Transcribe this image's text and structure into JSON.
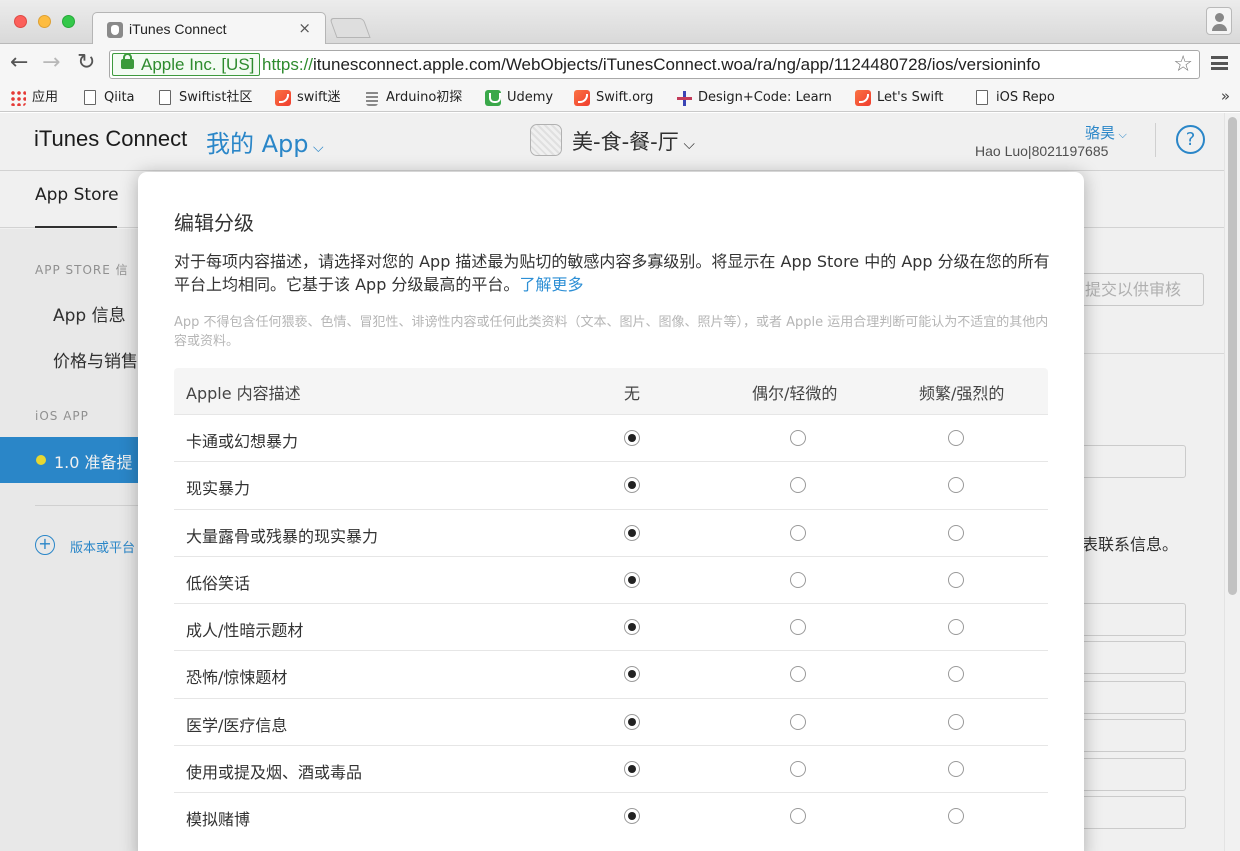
{
  "browser": {
    "tab_title": "iTunes Connect",
    "tab_close": "×",
    "ev_label": "Apple Inc. [US]",
    "url_proto": "https://",
    "url_rest": "itunesconnect.apple.com/WebObjects/iTunesConnect.woa/ra/ng/app/1124480728/ios/versioninfo",
    "bookmarks": [
      {
        "label": "应用",
        "icon": "apps-grid-icon"
      },
      {
        "label": "Qiita",
        "icon": "page-icon"
      },
      {
        "label": "Swiftist社区",
        "icon": "page-icon"
      },
      {
        "label": "swift迷",
        "icon": "swift-icon"
      },
      {
        "label": "Arduino初探",
        "icon": "arduino-icon"
      },
      {
        "label": "Udemy",
        "icon": "udemy-icon"
      },
      {
        "label": "Swift.org",
        "icon": "swift-icon"
      },
      {
        "label": "Design+Code: Learn",
        "icon": "plus-icon"
      },
      {
        "label": "Let's Swift",
        "icon": "swift-icon"
      },
      {
        "label": "iOS Repo",
        "icon": "page-icon"
      }
    ],
    "more": "»"
  },
  "header": {
    "brand": "iTunes Connect",
    "my_app": "我的 App",
    "app_name": "美-食-餐-厅",
    "user_name": "骆昊",
    "user_id": "Hao Luo|8021197685",
    "help": "?"
  },
  "subnav": {
    "app_store": "App Store"
  },
  "sidebar": {
    "heading_store": "APP STORE 信",
    "app_info": "App 信息",
    "pricing": "价格与销售",
    "heading_ios": "iOS APP",
    "active_version": "1.0 准备提",
    "add_label": "版本或平台"
  },
  "right_pane": {
    "submit": "提交以供审核",
    "contact_text": "表联系信息。"
  },
  "modal": {
    "title": "编辑分级",
    "desc": "对于每项内容描述，请选择对您的 App 描述最为贴切的敏感内容多寡级别。将显示在 App Store 中的 App 分级在您的所有平台上均相同。它基于该 App 分级最高的平台。",
    "learn_more": "了解更多",
    "note": "App 不得包含任何猥亵、色情、冒犯性、诽谤性内容或任何此类资料（文本、图片、图像、照片等），或者 Apple 运用合理判断可能认为不适宜的其他内容或资料。",
    "columns": {
      "desc": "Apple 内容描述",
      "none": "无",
      "mild": "偶尔/轻微的",
      "frequent": "频繁/强烈的"
    },
    "rows": [
      {
        "label": "卡通或幻想暴力",
        "selected": "none"
      },
      {
        "label": "现实暴力",
        "selected": "none"
      },
      {
        "label": "大量露骨或残暴的现实暴力",
        "selected": "none"
      },
      {
        "label": "低俗笑话",
        "selected": "none"
      },
      {
        "label": "成人/性暗示题材",
        "selected": "none"
      },
      {
        "label": "恐怖/惊悚题材",
        "selected": "none"
      },
      {
        "label": "医学/医疗信息",
        "selected": "none"
      },
      {
        "label": "使用或提及烟、酒或毒品",
        "selected": "none"
      },
      {
        "label": "模拟赌博",
        "selected": "none"
      }
    ]
  }
}
